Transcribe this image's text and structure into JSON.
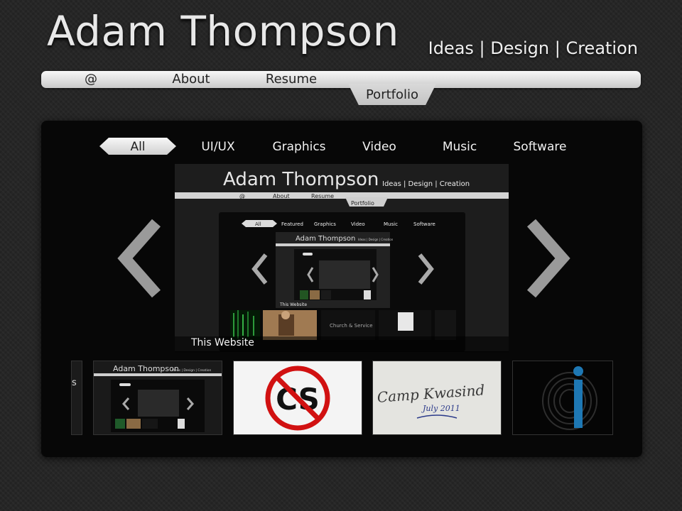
{
  "header": {
    "title": "Adam Thompson",
    "tagline": "Ideas | Design | Creation"
  },
  "nav": {
    "items": [
      {
        "label": "@"
      },
      {
        "label": "About"
      },
      {
        "label": "Resume"
      },
      {
        "label": "Portfolio",
        "active": true
      }
    ]
  },
  "portfolio": {
    "filters": [
      {
        "label": "All",
        "active": true
      },
      {
        "label": "UI/UX"
      },
      {
        "label": "Graphics"
      },
      {
        "label": "Video"
      },
      {
        "label": "Music"
      },
      {
        "label": "Software"
      }
    ],
    "featured": {
      "caption": "This Website",
      "preview": {
        "title": "Adam Thompson",
        "tagline": "Ideas | Design | Creation",
        "nav": [
          "@",
          "About",
          "Resume",
          "Portfolio"
        ],
        "filters": [
          "All",
          "Featured",
          "Graphics",
          "Video",
          "Music",
          "Software"
        ],
        "nested_title": "Adam Thompson",
        "nested_tagline": "Ideas | Design | Creation",
        "nested_caption": "This Website",
        "church_text": "Church & Service"
      }
    },
    "thumbnails": [
      {
        "name": "partial",
        "text": "s"
      },
      {
        "name": "this-website",
        "title": "Adam Thompson",
        "tagline": "Ideas | Design | Creation"
      },
      {
        "name": "no-cs",
        "text": "CS"
      },
      {
        "name": "camp-kwasind",
        "text": "Camp Kwasind",
        "date": "July 2011"
      },
      {
        "name": "fingerprint-i"
      }
    ]
  },
  "colors": {
    "background": "#262626",
    "panel": "#070707",
    "nav_gradient_top": "#f8f8f8",
    "nav_gradient_bottom": "#c9c9c9",
    "no_sign_red": "#d11111",
    "info_blue": "#1e78b4"
  }
}
